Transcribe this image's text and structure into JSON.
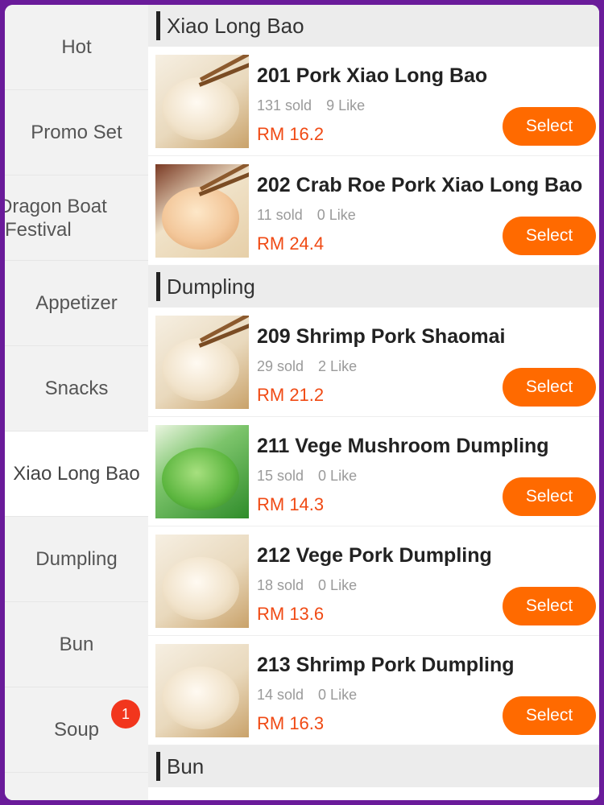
{
  "sidebar": {
    "items": [
      {
        "label": "Hot"
      },
      {
        "label": "Promo Set"
      },
      {
        "label": "Dragon Boat\nFestival"
      },
      {
        "label": "Appetizer"
      },
      {
        "label": "Snacks"
      },
      {
        "label": "Xiao Long Bao",
        "active": true
      },
      {
        "label": "Dumpling"
      },
      {
        "label": "Bun"
      },
      {
        "label": "Soup",
        "badge": "1"
      }
    ]
  },
  "sections": [
    {
      "title": "Xiao Long Bao",
      "items": [
        {
          "name": "201 Pork Xiao Long Bao",
          "sold": "131 sold",
          "likes": "9 Like",
          "price": "RM 16.2",
          "select": "Select"
        },
        {
          "name": "202 Crab Roe Pork Xiao Long Bao",
          "sold": "11 sold",
          "likes": "0 Like",
          "price": "RM 24.4",
          "select": "Select"
        }
      ]
    },
    {
      "title": "Dumpling",
      "items": [
        {
          "name": "209 Shrimp Pork Shaomai",
          "sold": "29 sold",
          "likes": "2 Like",
          "price": "RM 21.2",
          "select": "Select"
        },
        {
          "name": "211 Vege Mushroom Dumpling",
          "sold": "15 sold",
          "likes": "0 Like",
          "price": "RM 14.3",
          "select": "Select"
        },
        {
          "name": "212 Vege Pork Dumpling",
          "sold": "18 sold",
          "likes": "0 Like",
          "price": "RM 13.6",
          "select": "Select"
        },
        {
          "name": "213 Shrimp Pork Dumpling",
          "sold": "14 sold",
          "likes": "0 Like",
          "price": "RM 16.3",
          "select": "Select"
        }
      ]
    },
    {
      "title": "Bun",
      "items": []
    }
  ],
  "colors": {
    "accent": "#ff6a00",
    "price": "#f04a14",
    "badge": "#f2361d",
    "frame": "#6a1b9a"
  }
}
